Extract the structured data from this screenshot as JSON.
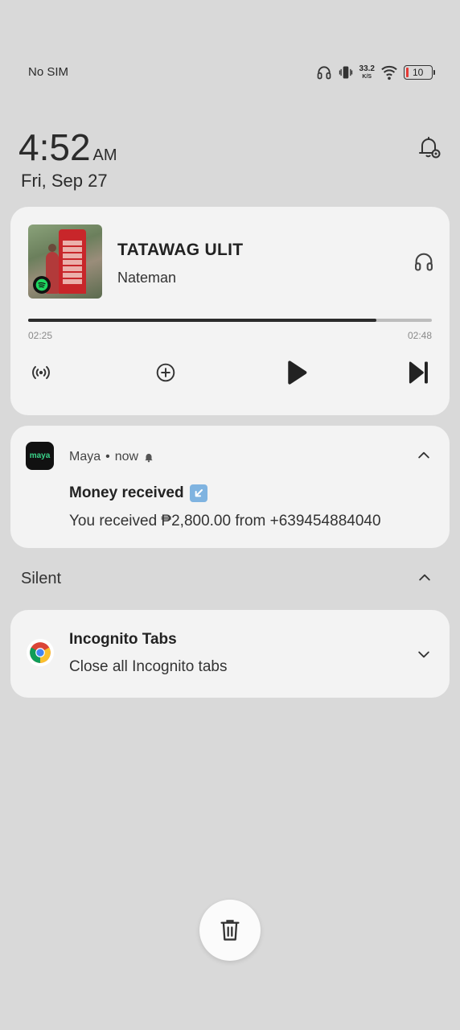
{
  "status_bar": {
    "carrier": "No SIM",
    "net_speed_value": "33.2",
    "net_speed_unit": "K/S",
    "battery_level": "10",
    "battery_color": "#e53935"
  },
  "lockscreen": {
    "time": "4:52",
    "ampm": "AM",
    "date": "Fri, Sep 27"
  },
  "media": {
    "app_icon": "spotify-icon",
    "title": "TATAWAG ULIT",
    "artist": "Nateman",
    "elapsed": "02:25",
    "total": "02:48",
    "progress_fraction": 0.863
  },
  "notifications": [
    {
      "app": "Maya",
      "separator": "•",
      "time": "now",
      "title": "Money received",
      "body": "You received ₱2,800.00 from +639454884040",
      "icon_label": "maya",
      "accent": "#3bd48a"
    },
    {
      "title": "Incognito Tabs",
      "body": "Close all Incognito tabs"
    }
  ],
  "sections": {
    "silent": "Silent"
  }
}
